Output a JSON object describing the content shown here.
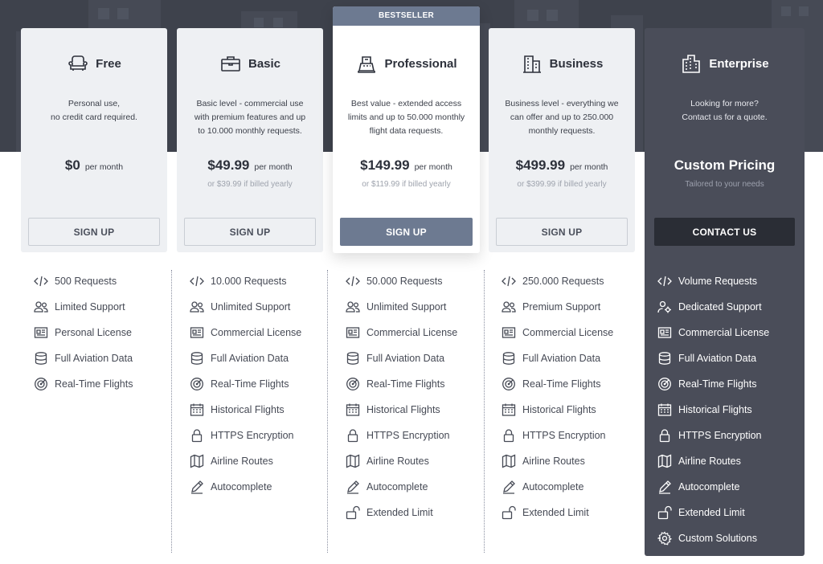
{
  "badge": "BESTSELLER",
  "plans": [
    {
      "name": "Free",
      "icon": "armchair-icon",
      "description": "Personal use,\nno credit card required.",
      "price": "$0",
      "period": "per month",
      "yearly": "",
      "button": "SIGN UP",
      "features": [
        {
          "icon": "code-icon",
          "label": "500 Requests"
        },
        {
          "icon": "users-icon",
          "label": "Limited Support"
        },
        {
          "icon": "license-icon",
          "label": "Personal License"
        },
        {
          "icon": "database-icon",
          "label": "Full Aviation Data"
        },
        {
          "icon": "radar-icon",
          "label": "Real-Time Flights"
        }
      ]
    },
    {
      "name": "Basic",
      "icon": "briefcase-icon",
      "description": "Basic level - commercial use\nwith premium features and up\nto 10.000 monthly requests.",
      "price": "$49.99",
      "period": "per month",
      "yearly": "or $39.99 if billed yearly",
      "button": "SIGN UP",
      "features": [
        {
          "icon": "code-icon",
          "label": "10.000 Requests"
        },
        {
          "icon": "users-icon",
          "label": "Unlimited Support"
        },
        {
          "icon": "license-icon",
          "label": "Commercial License"
        },
        {
          "icon": "database-icon",
          "label": "Full Aviation Data"
        },
        {
          "icon": "radar-icon",
          "label": "Real-Time Flights"
        },
        {
          "icon": "calendar-icon",
          "label": "Historical Flights"
        },
        {
          "icon": "lock-icon",
          "label": "HTTPS Encryption"
        },
        {
          "icon": "map-icon",
          "label": "Airline Routes"
        },
        {
          "icon": "pencil-icon",
          "label": "Autocomplete"
        }
      ]
    },
    {
      "name": "Professional",
      "icon": "cash-register-icon",
      "description": "Best value - extended access\nlimits and up to 50.000 monthly\nflight data requests.",
      "price": "$149.99",
      "period": "per month",
      "yearly": "or $119.99 if billed yearly",
      "button": "SIGN UP",
      "features": [
        {
          "icon": "code-icon",
          "label": "50.000 Requests"
        },
        {
          "icon": "users-icon",
          "label": "Unlimited Support"
        },
        {
          "icon": "license-icon",
          "label": "Commercial License"
        },
        {
          "icon": "database-icon",
          "label": "Full Aviation Data"
        },
        {
          "icon": "radar-icon",
          "label": "Real-Time Flights"
        },
        {
          "icon": "calendar-icon",
          "label": "Historical Flights"
        },
        {
          "icon": "lock-icon",
          "label": "HTTPS Encryption"
        },
        {
          "icon": "map-icon",
          "label": "Airline Routes"
        },
        {
          "icon": "pencil-icon",
          "label": "Autocomplete"
        },
        {
          "icon": "unlock-icon",
          "label": "Extended Limit"
        }
      ]
    },
    {
      "name": "Business",
      "icon": "building-icon",
      "description": "Business level - everything we\ncan offer and up to 250.000\nmonthly requests.",
      "price": "$499.99",
      "period": "per month",
      "yearly": "or $399.99 if billed yearly",
      "button": "SIGN UP",
      "features": [
        {
          "icon": "code-icon",
          "label": "250.000 Requests"
        },
        {
          "icon": "users-icon",
          "label": "Premium Support"
        },
        {
          "icon": "license-icon",
          "label": "Commercial License"
        },
        {
          "icon": "database-icon",
          "label": "Full Aviation Data"
        },
        {
          "icon": "radar-icon",
          "label": "Real-Time Flights"
        },
        {
          "icon": "calendar-icon",
          "label": "Historical Flights"
        },
        {
          "icon": "lock-icon",
          "label": "HTTPS Encryption"
        },
        {
          "icon": "map-icon",
          "label": "Airline Routes"
        },
        {
          "icon": "pencil-icon",
          "label": "Autocomplete"
        },
        {
          "icon": "unlock-icon",
          "label": "Extended Limit"
        }
      ]
    },
    {
      "name": "Enterprise",
      "icon": "office-tower-icon",
      "description": "Looking for more?\nContact us for a quote.",
      "price": "Custom Pricing",
      "period": "",
      "yearly": "Tailored to your needs",
      "button": "CONTACT US",
      "features": [
        {
          "icon": "code-icon",
          "label": "Volume Requests"
        },
        {
          "icon": "support-gear-icon",
          "label": "Dedicated Support"
        },
        {
          "icon": "license-icon",
          "label": "Commercial License"
        },
        {
          "icon": "database-icon",
          "label": "Full Aviation Data"
        },
        {
          "icon": "radar-icon",
          "label": "Real-Time Flights"
        },
        {
          "icon": "calendar-icon",
          "label": "Historical Flights"
        },
        {
          "icon": "lock-icon",
          "label": "HTTPS Encryption"
        },
        {
          "icon": "map-icon",
          "label": "Airline Routes"
        },
        {
          "icon": "pencil-icon",
          "label": "Autocomplete"
        },
        {
          "icon": "unlock-icon",
          "label": "Extended Limit"
        },
        {
          "icon": "cog-icon",
          "label": "Custom Solutions"
        }
      ]
    }
  ],
  "colors": {
    "header_bg": "#3e424c",
    "card_bg": "#eef0f3",
    "accent": "#6d7a91",
    "enterprise_bg": "#4a4d59",
    "dark_button": "#2a2d35"
  }
}
